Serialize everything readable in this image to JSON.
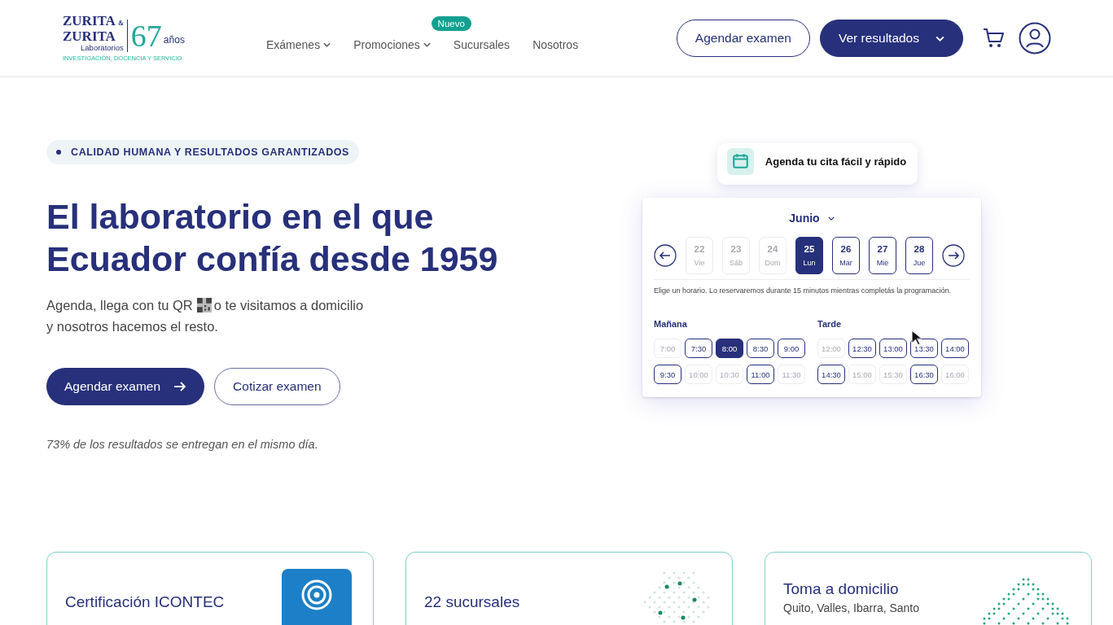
{
  "header": {
    "logo": {
      "line1": "ZURITA",
      "amp": "&",
      "line2": "ZURITA",
      "sub": "Laboratorios",
      "years": "67",
      "years_label": "años",
      "tagline": "INVESTIGACIÓN, DOCENCIA Y SERVICIO"
    },
    "nav": [
      {
        "label": "Exámenes",
        "dropdown": true
      },
      {
        "label": "Promociones",
        "dropdown": true,
        "badge": "Nuevo"
      },
      {
        "label": "Sucursales",
        "dropdown": false
      },
      {
        "label": "Nosotros",
        "dropdown": false
      }
    ],
    "buttons": [
      {
        "label": "Agendar examen",
        "kind": "outline",
        "dropdown": false
      },
      {
        "label": "Ver resultados",
        "kind": "filled",
        "dropdown": true
      }
    ]
  },
  "hero": {
    "tag": "CALIDAD HUMANA Y RESULTADOS GARANTIZADOS",
    "title": "El laboratorio en el que Ecuador confía desde 1959",
    "text_before": "Agenda, llega con tu QR",
    "text_after": "o te visitamos a domicilio",
    "text_line2": "y nosotros hacemos el resto.",
    "buttons": [
      {
        "label": "Agendar examen",
        "kind": "filled"
      },
      {
        "label": "Cotizar examen",
        "kind": "outline"
      }
    ],
    "note": "73% de los resultados se entregan en el mismo día."
  },
  "scheduler": {
    "popup": "Agenda tu cita fácil y rápido",
    "month": "Junio",
    "days": [
      {
        "num": "22",
        "day": "Vie",
        "disabled": true,
        "selected": false
      },
      {
        "num": "23",
        "day": "Sáb",
        "disabled": true,
        "selected": false
      },
      {
        "num": "24",
        "day": "Dom",
        "disabled": true,
        "selected": false
      },
      {
        "num": "25",
        "day": "Lun",
        "disabled": false,
        "selected": true
      },
      {
        "num": "26",
        "day": "Mar",
        "disabled": false,
        "selected": false
      },
      {
        "num": "27",
        "day": "Mie",
        "disabled": false,
        "selected": false
      },
      {
        "num": "28",
        "day": "Jue",
        "disabled": false,
        "selected": false
      }
    ],
    "note": "Elige un horario. Lo reservaremos durante 15 minutos mientras completás la programación.",
    "groups": [
      {
        "label": "Mañana",
        "slots": [
          {
            "time": "7:00",
            "disabled": true,
            "selected": false
          },
          {
            "time": "7:30",
            "disabled": false,
            "selected": false
          },
          {
            "time": "8:00",
            "disabled": false,
            "selected": true
          },
          {
            "time": "8:30",
            "disabled": false,
            "selected": false
          },
          {
            "time": "9:00",
            "disabled": false,
            "selected": false
          },
          {
            "time": "9:30",
            "disabled": false,
            "selected": false
          },
          {
            "time": "10:00",
            "disabled": true,
            "selected": false
          },
          {
            "time": "10:30",
            "disabled": true,
            "selected": false
          },
          {
            "time": "11:00",
            "disabled": false,
            "selected": false
          },
          {
            "time": "11:30",
            "disabled": true,
            "selected": false
          }
        ]
      },
      {
        "label": "Tarde",
        "slots": [
          {
            "time": "12:00",
            "disabled": true,
            "selected": false
          },
          {
            "time": "12:30",
            "disabled": false,
            "selected": false
          },
          {
            "time": "13:00",
            "disabled": false,
            "selected": false
          },
          {
            "time": "13:30",
            "disabled": false,
            "selected": false
          },
          {
            "time": "14:00",
            "disabled": false,
            "selected": false
          },
          {
            "time": "14:30",
            "disabled": false,
            "selected": false
          },
          {
            "time": "15:00",
            "disabled": true,
            "selected": false
          },
          {
            "time": "15:30",
            "disabled": true,
            "selected": false
          },
          {
            "time": "16:30",
            "disabled": false,
            "selected": false
          },
          {
            "time": "16:00",
            "disabled": true,
            "selected": false
          }
        ]
      }
    ]
  },
  "cards": [
    {
      "title": "Certificación ICONTEC",
      "kind": "certification"
    },
    {
      "title": "22 sucursales",
      "kind": "map"
    },
    {
      "title": "Toma a domicilio",
      "subtitle": "Quito, Valles, Ibarra, Santo",
      "kind": "home"
    }
  ]
}
